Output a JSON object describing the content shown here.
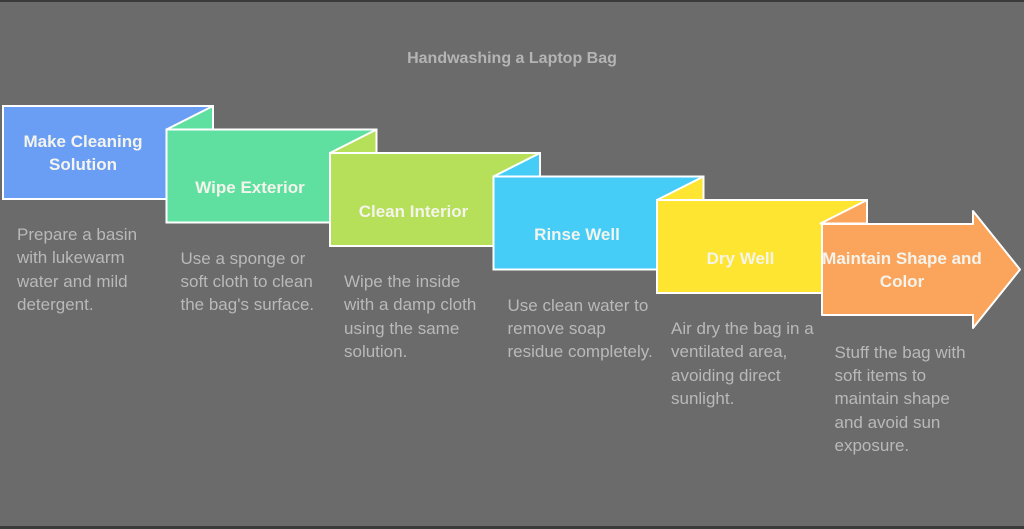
{
  "title": "Handwashing a Laptop Bag",
  "steps": [
    {
      "label": "Make Cleaning Solution",
      "color": "#6a9ef5",
      "description": "Prepare a basin with lukewarm water and mild detergent."
    },
    {
      "label": "Wipe Exterior",
      "color": "#5fe0a0",
      "description": "Use a sponge or soft cloth to clean the bag's surface."
    },
    {
      "label": "Clean Interior",
      "color": "#b6e05a",
      "description": "Wipe the inside with a damp cloth using the same solution."
    },
    {
      "label": "Rinse Well",
      "color": "#45cdf7",
      "description": "Use clean water to remove soap residue completely."
    },
    {
      "label": "Dry Well",
      "color": "#fde532",
      "description": "Air dry the bag in a ventilated area, avoiding direct sunlight."
    },
    {
      "label": "Maintain Shape and Color",
      "color": "#fba45c",
      "description": "Stuff the bag with soft items to maintain shape and avoid sun exposure."
    }
  ]
}
